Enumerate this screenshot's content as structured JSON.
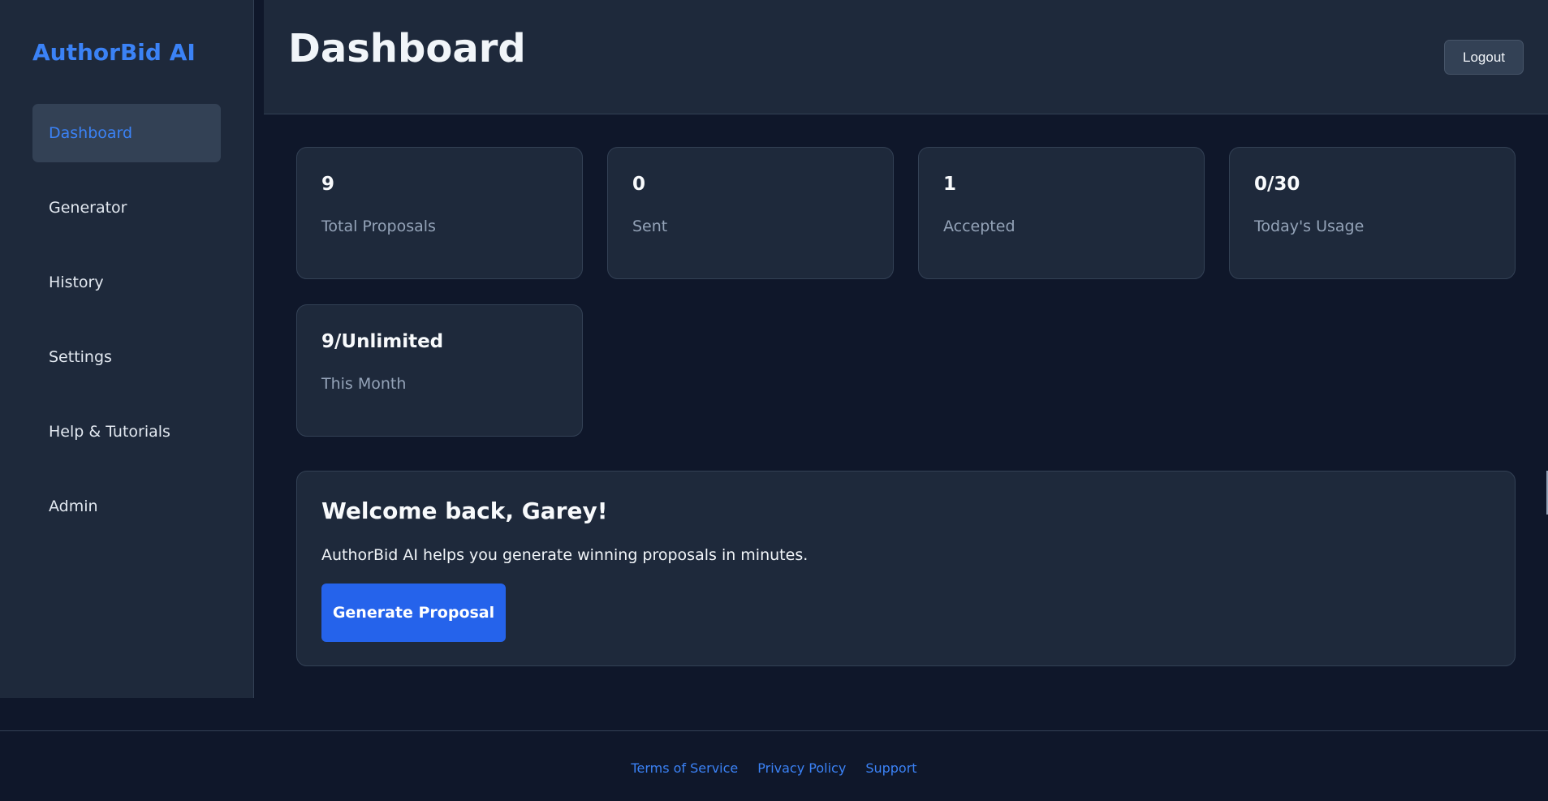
{
  "sidebar": {
    "brand": "AuthorBid AI",
    "items": [
      {
        "label": "Dashboard",
        "active": true
      },
      {
        "label": "Generator"
      },
      {
        "label": "History"
      },
      {
        "label": "Settings"
      },
      {
        "label": "Help & Tutorials"
      },
      {
        "label": "Admin"
      }
    ]
  },
  "header": {
    "title": "Dashboard",
    "logout_label": "Logout"
  },
  "stats": [
    {
      "value": "9",
      "label": "Total Proposals"
    },
    {
      "value": "0",
      "label": "Sent"
    },
    {
      "value": "1",
      "label": "Accepted"
    },
    {
      "value": "0/30",
      "label": "Today's Usage"
    },
    {
      "value": "9/Unlimited",
      "label": "This Month"
    }
  ],
  "welcome": {
    "title": "Welcome back, Garey!",
    "text": "AuthorBid AI helps you generate winning proposals in minutes.",
    "button_label": "Generate Proposal"
  },
  "footer": {
    "links": [
      "Terms of Service",
      "Privacy Policy",
      "Support"
    ]
  },
  "colors": {
    "accent": "#3b82f6",
    "primary_button": "#2563eb",
    "background": "#0f172a",
    "surface": "#1e293b"
  }
}
